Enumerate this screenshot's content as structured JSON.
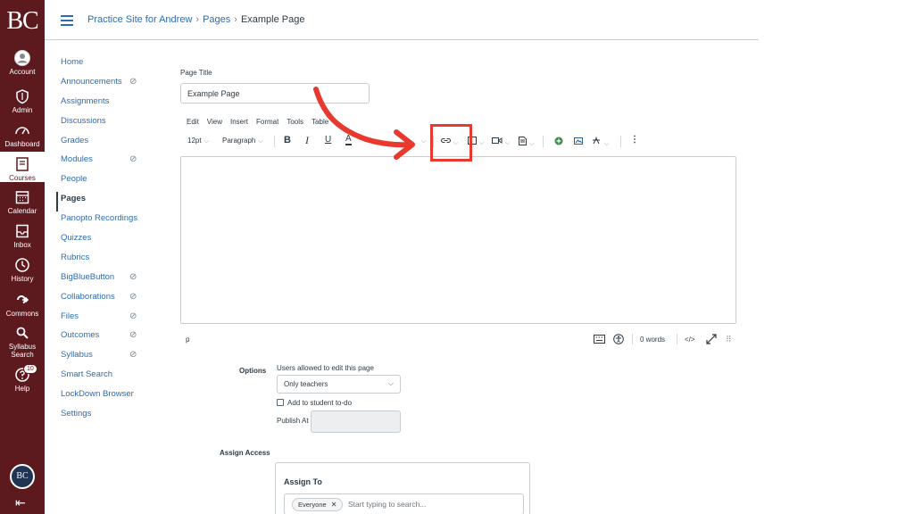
{
  "global_nav": {
    "logo": "BC",
    "items": [
      {
        "label": "Account",
        "icon": "account-icon"
      },
      {
        "label": "Admin",
        "icon": "admin-shield-icon"
      },
      {
        "label": "Dashboard",
        "icon": "dashboard-icon"
      },
      {
        "label": "Courses",
        "icon": "courses-icon",
        "active": true
      },
      {
        "label": "Calendar",
        "icon": "calendar-icon"
      },
      {
        "label": "Inbox",
        "icon": "inbox-icon"
      },
      {
        "label": "History",
        "icon": "history-icon"
      },
      {
        "label": "Commons",
        "icon": "commons-icon"
      },
      {
        "label1": "Syllabus",
        "label2": "Search",
        "icon": "syllabus-search-icon"
      },
      {
        "label": "Help",
        "icon": "help-icon",
        "badge": "10"
      }
    ],
    "bottom_logo": "BC",
    "collapse_glyph": "⇤"
  },
  "header": {
    "breadcrumbs": [
      "Practice Site for Andrew",
      "Pages",
      "Example Page"
    ],
    "separator": "›"
  },
  "course_nav": {
    "items": [
      {
        "label": "Home"
      },
      {
        "label": "Announcements",
        "hidden": true
      },
      {
        "label": "Assignments"
      },
      {
        "label": "Discussions"
      },
      {
        "label": "Grades"
      },
      {
        "label": "Modules",
        "hidden": true
      },
      {
        "label": "People"
      },
      {
        "label": "Pages",
        "active": true
      },
      {
        "label": "Panopto Recordings"
      },
      {
        "label": "Quizzes"
      },
      {
        "label": "Rubrics"
      },
      {
        "label": "BigBlueButton",
        "hidden": true
      },
      {
        "label": "Collaborations",
        "hidden": true
      },
      {
        "label": "Files",
        "hidden": true
      },
      {
        "label": "Outcomes",
        "hidden": true
      },
      {
        "label": "Syllabus",
        "hidden": true
      },
      {
        "label": "Smart Search"
      },
      {
        "label": "LockDown Browser"
      },
      {
        "label": "Settings"
      }
    ]
  },
  "editor": {
    "page_title_label": "Page Title",
    "page_title_value": "Example Page",
    "menus": [
      "Edit",
      "View",
      "Insert",
      "Format",
      "Tools",
      "Table"
    ],
    "font_size": "12pt",
    "block_format": "Paragraph",
    "bold": "B",
    "italic": "I",
    "underline": "U",
    "text_color": "A",
    "more": "⋮",
    "status_path": "p",
    "word_count": "0 words",
    "html_toggle": "</>",
    "highlight_color": "#e8392e"
  },
  "options": {
    "label": "Options",
    "edit_label": "Users allowed to edit this page",
    "edit_value": "Only teachers",
    "todo_label": "Add to student to-do",
    "publish_label": "Publish At"
  },
  "assign_access": {
    "label": "Assign Access",
    "card_title": "Assign To",
    "chip_label": "Everyone",
    "chip_remove": "✕",
    "search_placeholder": "Start typing to search..."
  }
}
